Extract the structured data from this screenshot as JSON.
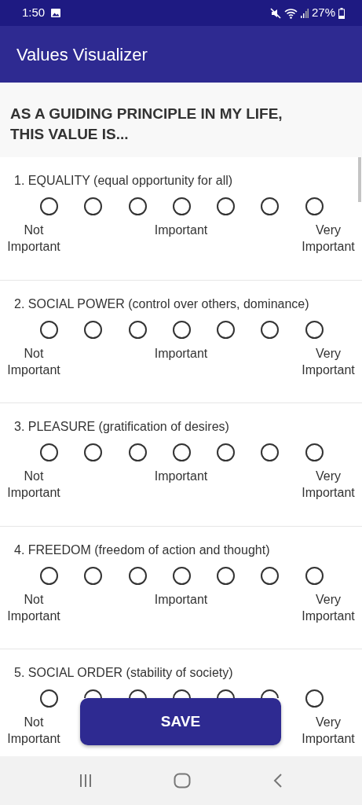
{
  "status_bar": {
    "time": "1:50",
    "battery": "27%"
  },
  "app_bar": {
    "title": "Values Visualizer"
  },
  "prompt": "AS A GUIDING PRINCIPLE IN MY LIFE, THIS VALUE IS...",
  "questions": [
    {
      "title": "1. EQUALITY (equal opportunity for all)",
      "options": [
        {
          "selected": false
        },
        {
          "selected": false
        },
        {
          "selected": false
        },
        {
          "selected": false
        },
        {
          "selected": false
        },
        {
          "selected": false
        },
        {
          "selected": false
        }
      ],
      "label_left": "Not Important",
      "label_middle": "Important",
      "label_right": "Very Important"
    },
    {
      "title": "2. SOCIAL POWER (control over others, dominance)",
      "options": [
        {
          "selected": false
        },
        {
          "selected": false
        },
        {
          "selected": false
        },
        {
          "selected": false
        },
        {
          "selected": false
        },
        {
          "selected": false
        },
        {
          "selected": false
        }
      ],
      "label_left": "Not Important",
      "label_middle": "Important",
      "label_right": "Very Important"
    },
    {
      "title": "3. PLEASURE (gratification of desires)",
      "options": [
        {
          "selected": false
        },
        {
          "selected": false
        },
        {
          "selected": false
        },
        {
          "selected": false
        },
        {
          "selected": false
        },
        {
          "selected": false
        },
        {
          "selected": false
        }
      ],
      "label_left": "Not Important",
      "label_middle": "Important",
      "label_right": "Very Important"
    },
    {
      "title": "4. FREEDOM (freedom of action and thought)",
      "options": [
        {
          "selected": false
        },
        {
          "selected": false
        },
        {
          "selected": false
        },
        {
          "selected": false
        },
        {
          "selected": false
        },
        {
          "selected": false
        },
        {
          "selected": false
        }
      ],
      "label_left": "Not Important",
      "label_middle": "Important",
      "label_right": "Very Important"
    },
    {
      "title": "5. SOCIAL ORDER (stability of society)",
      "options": [
        {
          "selected": false
        },
        {
          "selected": false
        },
        {
          "selected": false
        },
        {
          "selected": false
        },
        {
          "selected": false
        },
        {
          "selected": false
        },
        {
          "selected": false
        }
      ],
      "label_left": "Not Important",
      "label_right": "Very Important"
    }
  ],
  "save_button": "SAVE"
}
